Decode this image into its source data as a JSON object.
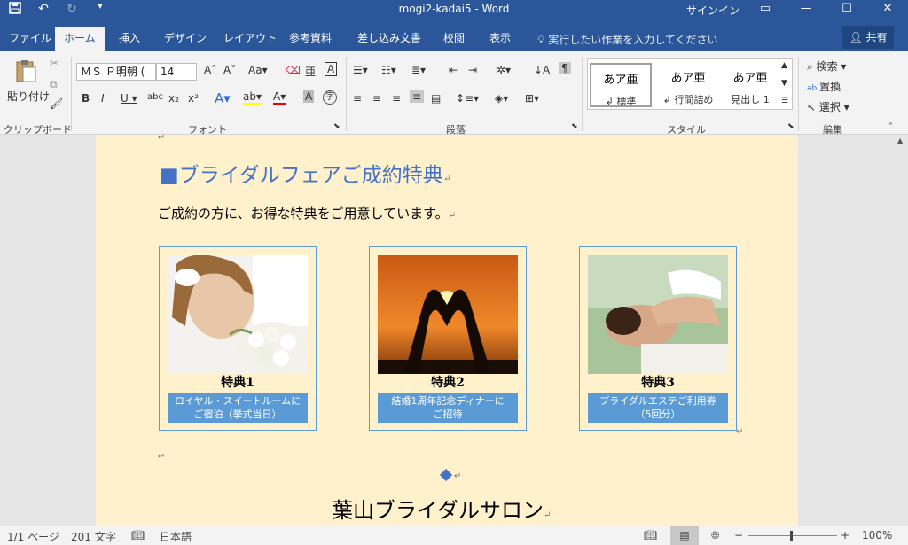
{
  "titlebar": {
    "doc_title": "mogi2-kadai5 - Word",
    "signin": "サインイン",
    "save_icon": "save-icon",
    "undo_icon": "undo-icon",
    "redo_icon": "redo-icon"
  },
  "tabs": [
    "ファイル",
    "ホーム",
    "挿入",
    "デザイン",
    "レイアウト",
    "参考資料",
    "差し込み文書",
    "校閲",
    "表示"
  ],
  "tell_me": "実行したい作業を入力してください",
  "share": "共有",
  "ribbon": {
    "clipboard": {
      "paste": "貼り付け",
      "label": "クリップボード"
    },
    "font": {
      "name": "ＭＳ Ｐ明朝 (",
      "size": "14",
      "label": "フォント"
    },
    "paragraph": {
      "label": "段落"
    },
    "styles": {
      "label": "スタイル",
      "items": [
        {
          "preview": "あア亜",
          "name": "↲ 標準"
        },
        {
          "preview": "あア亜",
          "name": "↲ 行間詰め"
        },
        {
          "preview": "あア亜",
          "name": "見出し 1"
        }
      ]
    },
    "editing": {
      "find": "検索",
      "replace": "置換",
      "select": "選択",
      "label": "編集"
    }
  },
  "document": {
    "heading": "■ブライダルフェアご成約特典",
    "intro": "ご成約の方に、お得な特典をご用意しています。",
    "cards": [
      {
        "title": "特典1",
        "line1": "ロイヤル・スイートルームに",
        "line2": "ご宿泊（挙式当日）"
      },
      {
        "title": "特典2",
        "line1": "結婚1周年記念ディナーに",
        "line2": "ご招待"
      },
      {
        "title": "特典3",
        "line1": "ブライダルエステご利用券",
        "line2": "（5回分）"
      }
    ],
    "footer_title": "葉山ブライダルサロン",
    "para_mark": "↵"
  },
  "status": {
    "page": "1/1 ページ",
    "words": "201 文字",
    "lang": "日本語",
    "zoom": "100%"
  }
}
